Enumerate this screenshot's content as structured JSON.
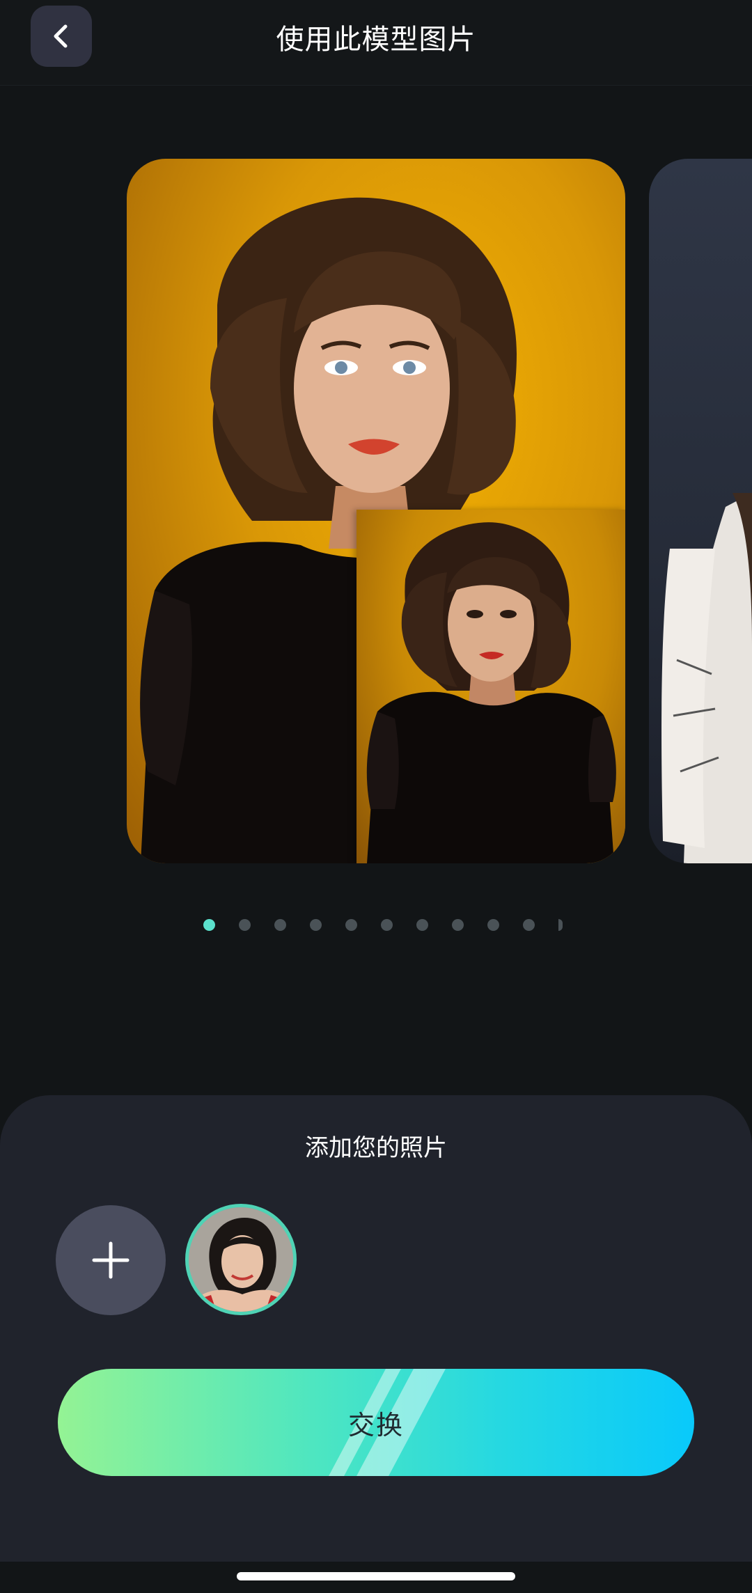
{
  "header": {
    "title": "使用此模型图片",
    "back_icon": "chevron-left-icon"
  },
  "carousel": {
    "cards": [
      {
        "name": "model-portrait-golden",
        "background": "#e0a005"
      },
      {
        "name": "model-portrait-gray",
        "background": "#2b3140"
      }
    ],
    "dots": {
      "count": 11,
      "active_index": 0,
      "active_color": "#5be0cc",
      "inactive_color": "#4a5257"
    }
  },
  "sheet": {
    "title": "添加您的照片",
    "add_icon": "plus-icon",
    "selected_photo_border": "#4fd3b5"
  },
  "action": {
    "swap_label": "交换",
    "gradient_start": "#94f394",
    "gradient_end": "#09c9fb"
  }
}
